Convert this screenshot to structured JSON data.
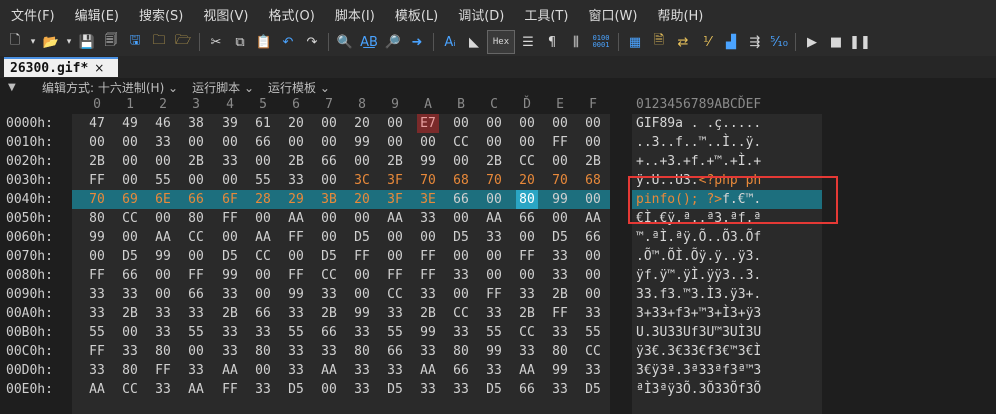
{
  "menu": [
    "文件(F)",
    "编辑(E)",
    "搜索(S)",
    "视图(V)",
    "格式(O)",
    "脚本(I)",
    "模板(L)",
    "调试(D)",
    "工具(T)",
    "窗口(W)",
    "帮助(H)"
  ],
  "toolbar": {
    "hex_label": "Hex",
    "bits_label": "0100\n0001"
  },
  "tab": {
    "title": "26300.gif*",
    "close": "×"
  },
  "subbar": {
    "collapse": "▼",
    "edit_mode": "编辑方式: 十六进制(H) ⌄",
    "run_script": "运行脚本 ⌄",
    "run_template": "运行模板 ⌄"
  },
  "hex": {
    "columns": [
      "0",
      "1",
      "2",
      "3",
      "4",
      "5",
      "6",
      "7",
      "8",
      "9",
      "A",
      "B",
      "C",
      "Ď",
      "E",
      "F"
    ],
    "ascii_header": "0123456789ABCĎEF",
    "rows": [
      {
        "offset": "0000h:",
        "bytes": [
          "47",
          "49",
          "46",
          "38",
          "39",
          "61",
          "20",
          "00",
          "20",
          "00",
          "E7",
          "00",
          "00",
          "00",
          "00",
          "00"
        ],
        "ascii": "GIF89a . .ç....."
      },
      {
        "offset": "0010h:",
        "bytes": [
          "00",
          "00",
          "33",
          "00",
          "00",
          "66",
          "00",
          "00",
          "99",
          "00",
          "00",
          "CC",
          "00",
          "00",
          "FF",
          "00"
        ],
        "ascii": "..3..f..™..Ì..ÿ."
      },
      {
        "offset": "0020h:",
        "bytes": [
          "2B",
          "00",
          "00",
          "2B",
          "33",
          "00",
          "2B",
          "66",
          "00",
          "2B",
          "99",
          "00",
          "2B",
          "CC",
          "00",
          "2B"
        ],
        "ascii": "+..+3.+f.+™.+Ì.+"
      },
      {
        "offset": "0030h:",
        "bytes": [
          "FF",
          "00",
          "55",
          "00",
          "00",
          "55",
          "33",
          "00",
          "3C",
          "3F",
          "70",
          "68",
          "70",
          "20",
          "70",
          "68"
        ],
        "ascii": "ÿ.U..U3.<?php ph"
      },
      {
        "offset": "0040h:",
        "bytes": [
          "70",
          "69",
          "6E",
          "66",
          "6F",
          "28",
          "29",
          "3B",
          "20",
          "3F",
          "3E",
          "66",
          "00",
          "80",
          "99",
          "00"
        ],
        "ascii": "pinfo(); ?>f.€™."
      },
      {
        "offset": "0050h:",
        "bytes": [
          "80",
          "CC",
          "00",
          "80",
          "FF",
          "00",
          "AA",
          "00",
          "00",
          "AA",
          "33",
          "00",
          "AA",
          "66",
          "00",
          "AA"
        ],
        "ascii": "€Ì.€ÿ.ª..ª3.ªf.ª"
      },
      {
        "offset": "0060h:",
        "bytes": [
          "99",
          "00",
          "AA",
          "CC",
          "00",
          "AA",
          "FF",
          "00",
          "D5",
          "00",
          "00",
          "D5",
          "33",
          "00",
          "D5",
          "66"
        ],
        "ascii": "™.ªÌ.ªÿ.Õ..Õ3.Õf"
      },
      {
        "offset": "0070h:",
        "bytes": [
          "00",
          "D5",
          "99",
          "00",
          "D5",
          "CC",
          "00",
          "D5",
          "FF",
          "00",
          "FF",
          "00",
          "00",
          "FF",
          "33",
          "00"
        ],
        "ascii": ".Õ™.ÕÌ.Õÿ.ÿ..ÿ3."
      },
      {
        "offset": "0080h:",
        "bytes": [
          "FF",
          "66",
          "00",
          "FF",
          "99",
          "00",
          "FF",
          "CC",
          "00",
          "FF",
          "FF",
          "33",
          "00",
          "00",
          "33",
          "00"
        ],
        "ascii": "ÿf.ÿ™.ÿÌ.ÿÿ3..3."
      },
      {
        "offset": "0090h:",
        "bytes": [
          "33",
          "33",
          "00",
          "66",
          "33",
          "00",
          "99",
          "33",
          "00",
          "CC",
          "33",
          "00",
          "FF",
          "33",
          "2B",
          "00"
        ],
        "ascii": "33.f3.™3.Ì3.ÿ3+."
      },
      {
        "offset": "00A0h:",
        "bytes": [
          "33",
          "2B",
          "33",
          "33",
          "2B",
          "66",
          "33",
          "2B",
          "99",
          "33",
          "2B",
          "CC",
          "33",
          "2B",
          "FF",
          "33"
        ],
        "ascii": "3+33+f3+™3+Ì3+ÿ3"
      },
      {
        "offset": "00B0h:",
        "bytes": [
          "55",
          "00",
          "33",
          "55",
          "33",
          "33",
          "55",
          "66",
          "33",
          "55",
          "99",
          "33",
          "55",
          "CC",
          "33",
          "55"
        ],
        "ascii": "U.3U33Uf3U™3UÌ3U"
      },
      {
        "offset": "00C0h:",
        "bytes": [
          "FF",
          "33",
          "80",
          "00",
          "33",
          "80",
          "33",
          "33",
          "80",
          "66",
          "33",
          "80",
          "99",
          "33",
          "80",
          "CC"
        ],
        "ascii": "ÿ3€.3€33€f3€™3€Ì"
      },
      {
        "offset": "00D0h:",
        "bytes": [
          "33",
          "80",
          "FF",
          "33",
          "AA",
          "00",
          "33",
          "AA",
          "33",
          "33",
          "AA",
          "66",
          "33",
          "AA",
          "99",
          "33"
        ],
        "ascii": "3€ÿ3ª.3ª33ªf3ª™3"
      },
      {
        "offset": "00E0h:",
        "bytes": [
          "AA",
          "CC",
          "33",
          "AA",
          "FF",
          "33",
          "D5",
          "00",
          "33",
          "D5",
          "33",
          "33",
          "D5",
          "66",
          "33",
          "D5"
        ],
        "ascii": "ªÌ3ªÿ3Õ.3Õ33Õf3Õ"
      }
    ]
  }
}
